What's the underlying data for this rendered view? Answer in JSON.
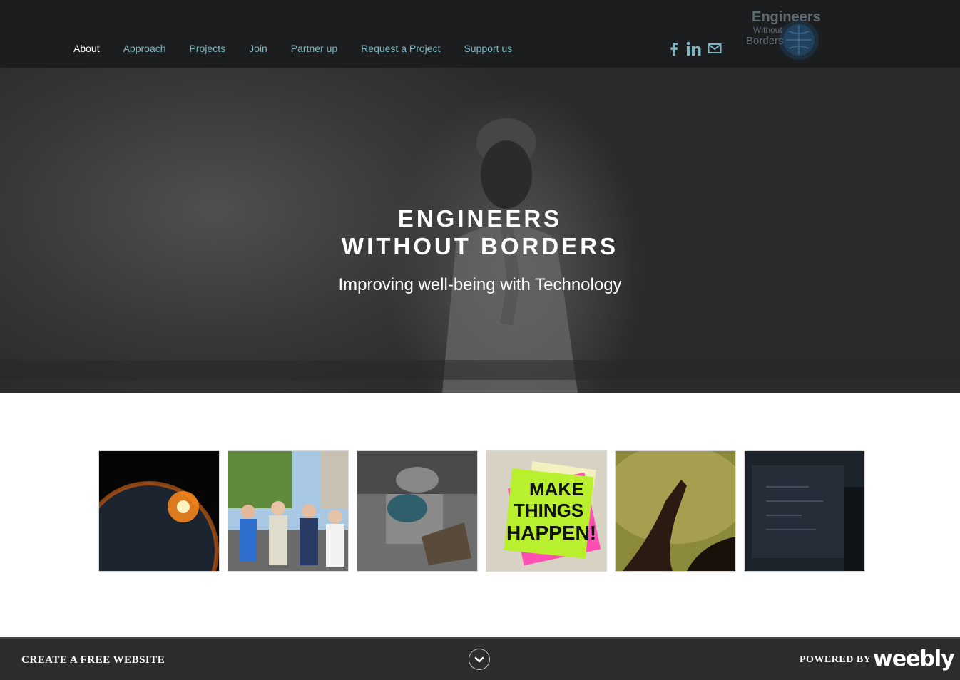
{
  "nav": {
    "items": [
      {
        "label": "About",
        "active": true
      },
      {
        "label": "Approach"
      },
      {
        "label": "Projects"
      },
      {
        "label": "Join"
      },
      {
        "label": "Partner up"
      },
      {
        "label": "Request a Project"
      },
      {
        "label": "Support us"
      }
    ]
  },
  "social": [
    "facebook-icon",
    "linkedin-icon",
    "mail-icon"
  ],
  "logo": {
    "line1": "Engineers",
    "line2": "Without",
    "line3": "Borders"
  },
  "hero": {
    "title_line1": "ENGINEERS",
    "title_line2": "WITHOUT BORDERS",
    "subtitle": "Improving well-being with Technology"
  },
  "gallery": {
    "note_text": [
      "MAKE",
      "THINGS",
      "HAPPEN!"
    ]
  },
  "footer": {
    "cta": "CREATE A FREE WEBSITE",
    "powered": "POWERED BY",
    "brand": "weebly"
  },
  "colors": {
    "nav_link": "#7fb6c4",
    "nav_active": "#ffffff",
    "header_bg": "#1c1d1e",
    "footer_bg": "#2c2d2f"
  }
}
